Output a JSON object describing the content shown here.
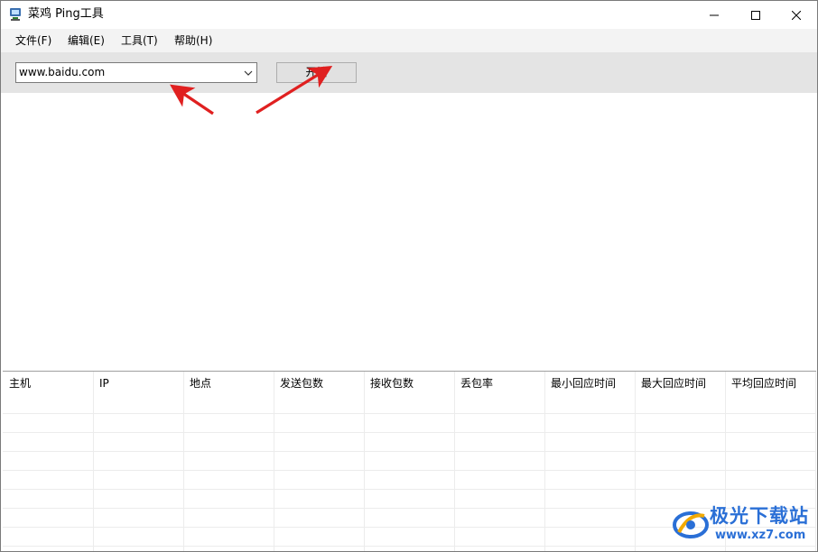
{
  "window": {
    "title": "菜鸡 Ping工具"
  },
  "menu": {
    "items": [
      "文件(F)",
      "编辑(E)",
      "工具(T)",
      "帮助(H)"
    ]
  },
  "toolbar": {
    "host_value": "www.baidu.com",
    "start_label": "开始"
  },
  "table": {
    "columns": [
      "主机",
      "IP",
      "地点",
      "发送包数",
      "接收包数",
      "丢包率",
      "最小回应时间",
      "最大回应时间",
      "平均回应时间"
    ]
  },
  "watermark": {
    "brand": "极光下载站",
    "url": "www.xz7.com"
  },
  "colors": {
    "annotation_arrow": "#e02020",
    "watermark": "#2a6fd6",
    "toolbar_bg": "#e4e4e4",
    "menubar_bg": "#f3f3f3"
  }
}
